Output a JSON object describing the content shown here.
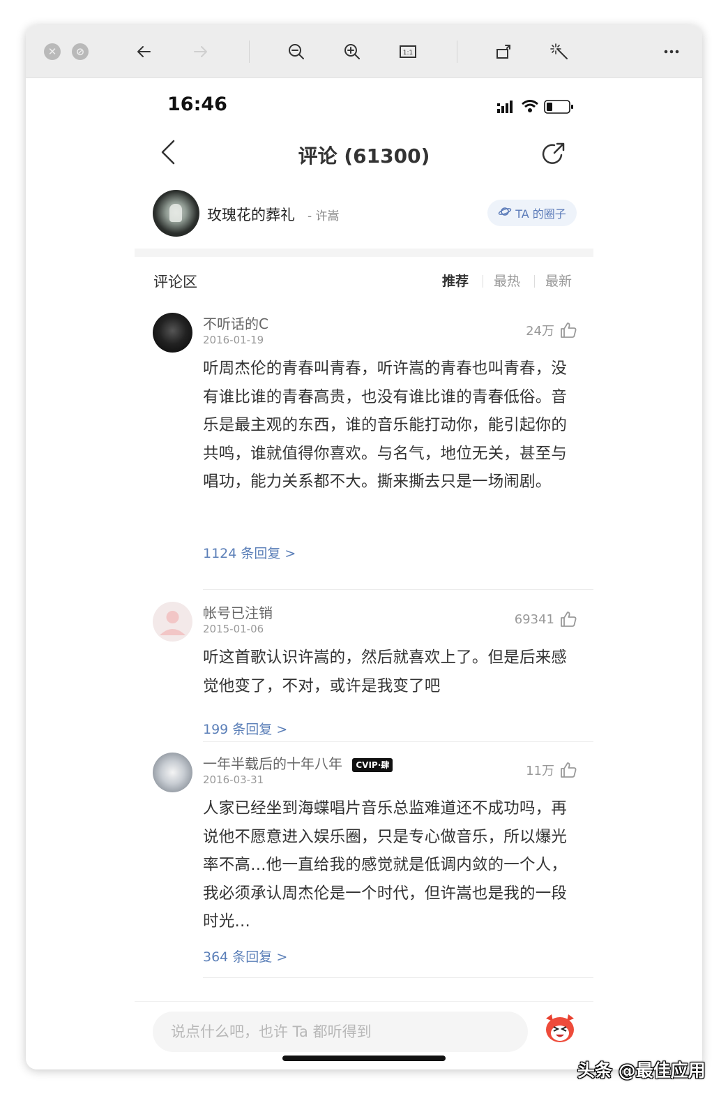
{
  "status": {
    "time": "16:46"
  },
  "toolbar": {
    "icons": [
      "close-icon",
      "block-icon",
      "back-arrow-icon",
      "forward-arrow-icon",
      "zoom-out-icon",
      "zoom-in-icon",
      "actual-size-icon",
      "rotate-icon",
      "magic-wand-icon",
      "more-icon"
    ],
    "actual_size_label": "1:1"
  },
  "nav": {
    "title": "评论 (61300)"
  },
  "song": {
    "name": "玫瑰花的葬礼",
    "artist": "- 许嵩",
    "circle_button": "TA 的圈子"
  },
  "comments_section": {
    "title": "评论区",
    "sort_tabs": [
      {
        "label": "推荐",
        "active": true
      },
      {
        "label": "最热",
        "active": false
      },
      {
        "label": "最新",
        "active": false
      }
    ]
  },
  "comments": [
    {
      "user": "不听话的C",
      "date": "2016-01-19",
      "likes": "24万",
      "text": "听周杰伦的青春叫青春，听许嵩的青春也叫青春，没有谁比谁的青春高贵，也没有谁比谁的青春低俗。音乐是最主观的东西，谁的音乐能打动你，能引起你的共鸣，谁就值得你喜欢。与名气，地位无关，甚至与唱功，能力关系都不大。撕来撕去只是一场闹剧。",
      "replies": "1124 条回复 >"
    },
    {
      "user": "帐号已注销",
      "date": "2015-01-06",
      "likes": "69341",
      "text": "听这首歌认识许嵩的，然后就喜欢上了。但是后来感觉他变了，不对，或许是我变了吧",
      "replies": "199 条回复 >"
    },
    {
      "user": "一年半载后的十年八年",
      "badge": "CVIP·肆",
      "date": "2016-03-31",
      "likes": "11万",
      "text": "人家已经坐到海蝶唱片音乐总监难道还不成功吗，再说他不愿意进入娱乐圈，只是专心做音乐，所以爆光率不高…他一直给我的感觉就是低调内敛的一个人，我必须承认周杰伦是一个时代，但许嵩也是我的一段时光…",
      "replies": "364 条回复 >"
    }
  ],
  "input": {
    "placeholder": "说点什么吧，也许 Ta 都听得到"
  },
  "watermark": "头条 @最佳应用",
  "colors": {
    "accent": "#5b7fb8",
    "toolbar_bg": "#ededed",
    "text": "#333333"
  }
}
